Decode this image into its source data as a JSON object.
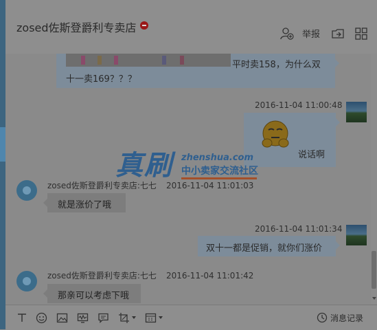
{
  "header": {
    "title": "zosed佐斯登爵利专卖店",
    "report_label": "举报"
  },
  "messages": {
    "m1_text": "平时卖158，为什么双十一卖169？？？",
    "m2_time": "2016-11-04 11:00:48",
    "m2_text": "说话啊",
    "m3_sender": "zosed佐斯登爵利专卖店:七七",
    "m3_time": "2016-11-04 11:01:03",
    "m3_text": "就是涨价了哦",
    "m4_time": "2016-11-04 11:01:34",
    "m4_text": "双十一都是促销，就你们涨价",
    "m5_sender": "zosed佐斯登爵利专卖店:七七",
    "m5_time": "2016-11-04 11:01:42",
    "m5_text": "那亲可以考虑下哦"
  },
  "watermark": {
    "big": "真刷",
    "url": "zhenshua.com",
    "sub": "中小卖家交流社区"
  },
  "toolbar": {
    "history_label": "消息记录"
  },
  "icons": {
    "header": [
      "person-add-icon",
      "report-label",
      "share-icon",
      "grid-icon"
    ],
    "toolbar": [
      "font-icon",
      "emoji-icon",
      "image-icon",
      "shake-icon",
      "quick-reply-icon",
      "screenshot-icon",
      "card-icon",
      "clock-icon"
    ]
  }
}
